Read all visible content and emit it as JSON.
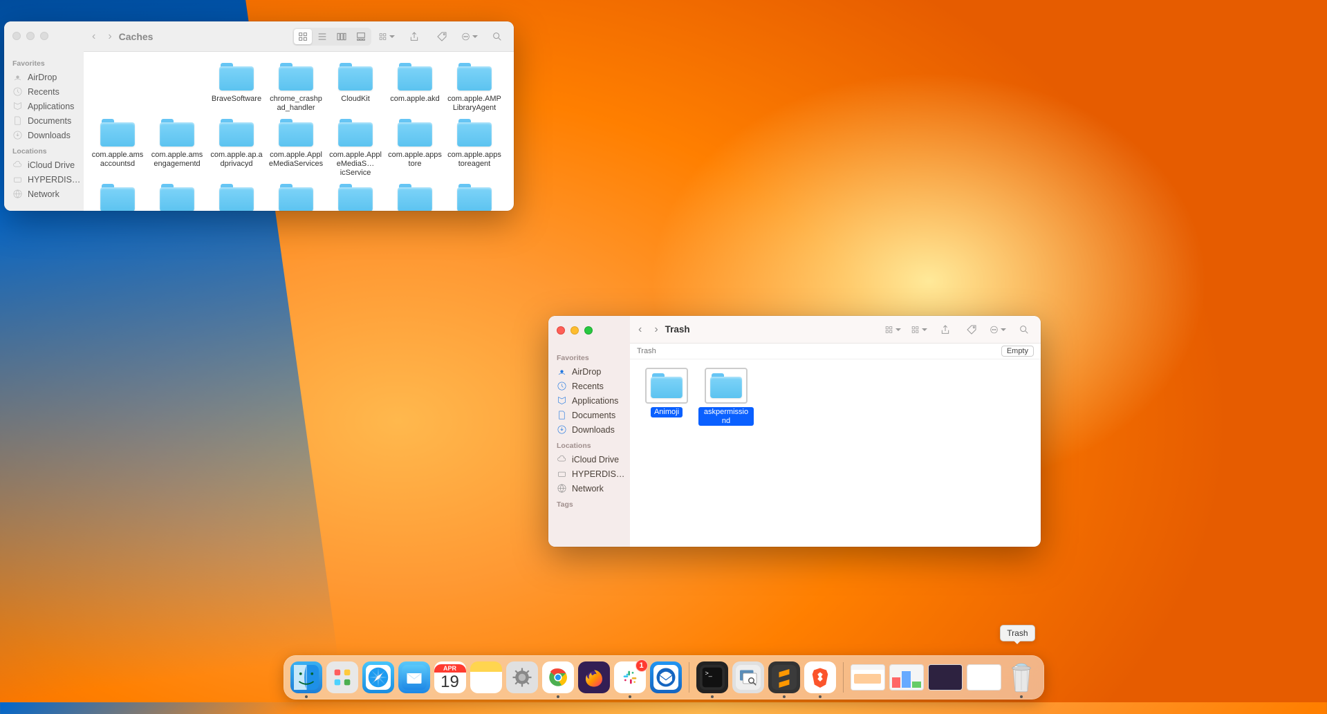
{
  "window1": {
    "title": "Caches",
    "sidebar": {
      "favorites_label": "Favorites",
      "favorites": [
        "AirDrop",
        "Recents",
        "Applications",
        "Documents",
        "Downloads"
      ],
      "locations_label": "Locations",
      "locations": [
        "iCloud Drive",
        "HYPERDIS…",
        "Network"
      ]
    },
    "folders": [
      "BraveSoftware",
      "chrome_crashpad_handler",
      "CloudKit",
      "com.apple.akd",
      "com.apple.AMPLibraryAgent",
      "com.apple.amsaccountsd",
      "com.apple.amsengagementd",
      "com.apple.ap.adprivacyd",
      "com.apple.AppleMediaServices",
      "com.apple.AppleMediaS…icService",
      "com.apple.appstore",
      "com.apple.appstoreagent",
      "",
      "",
      "",
      "",
      "",
      "",
      ""
    ]
  },
  "window2": {
    "title": "Trash",
    "subheader": "Trash",
    "empty_button": "Empty",
    "sidebar": {
      "favorites_label": "Favorites",
      "favorites": [
        "AirDrop",
        "Recents",
        "Applications",
        "Documents",
        "Downloads"
      ],
      "locations_label": "Locations",
      "locations": [
        "iCloud Drive",
        "HYPERDIS…",
        "Network"
      ],
      "tags_label": "Tags"
    },
    "folders": [
      "Animoji",
      "askpermissiond"
    ]
  },
  "dock": {
    "calendar": {
      "month": "APR",
      "day": "19"
    },
    "slack_badge": "1",
    "tooltip": "Trash",
    "apps": [
      "Finder",
      "Launchpad",
      "Safari",
      "Mail",
      "Calendar",
      "Notes",
      "System Settings",
      "Chrome",
      "Firefox",
      "Slack",
      "Thunderbird"
    ],
    "apps2": [
      "Terminal",
      "Preview",
      "Sublime Text",
      "Brave"
    ],
    "trash_label": "Trash"
  }
}
